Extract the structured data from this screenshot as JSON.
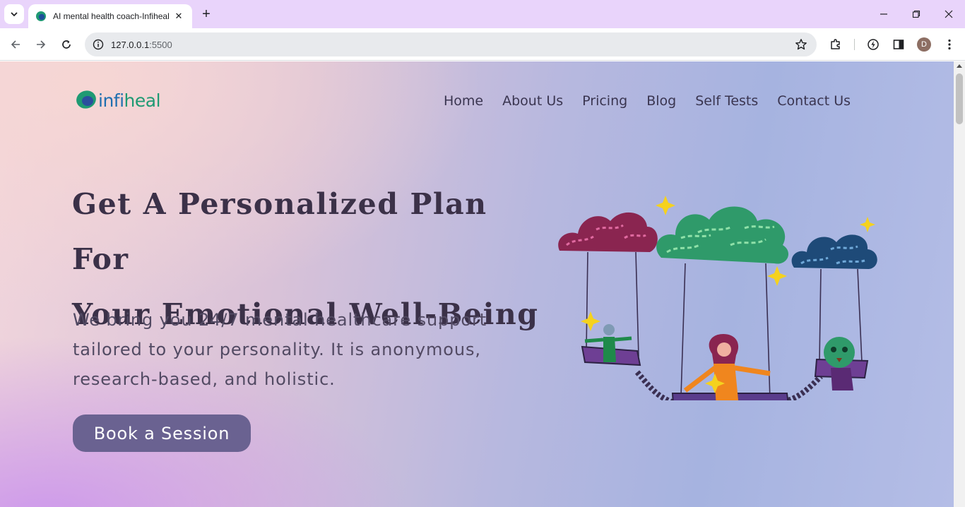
{
  "browser": {
    "tab_title": "AI mental health coach-Infiheal",
    "new_tab_symbol": "+",
    "url_host": "127.0.0.1",
    "url_port": ":5500",
    "profile_initial": "D",
    "icons": [
      "tab-search-icon",
      "back-icon",
      "forward-icon",
      "reload-icon",
      "site-info-icon",
      "bookmark-star-icon",
      "extensions-icon",
      "performance-icon",
      "side-panel-icon",
      "menu-kebab-icon",
      "minimize-icon",
      "maximize-icon",
      "close-icon"
    ]
  },
  "site": {
    "logo": {
      "text_a": "infi",
      "text_b": "heal"
    },
    "nav": [
      "Home",
      "About Us",
      "Pricing",
      "Blog",
      "Self Tests",
      "Contact Us"
    ],
    "hero": {
      "title_line_1": "Get A Personalized Plan For",
      "title_line_2": "Your Emotional Well-Being",
      "subtitle": "We bring you 24/7 mental healthcare support tailored to your personality. It is anonymous, research-based, and holistic.",
      "cta_label": "Book a Session"
    },
    "colors": {
      "brand_blue": "#1e6fb0",
      "brand_green": "#1f9a73",
      "text_dark": "#3b3148",
      "cta_bg": "#6a6291"
    }
  }
}
